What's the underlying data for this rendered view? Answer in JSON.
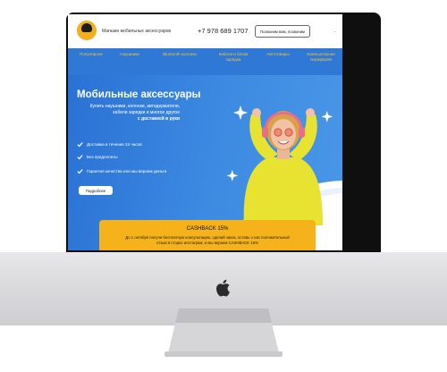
{
  "header": {
    "tagline": "Магазин мобильных аксессуаров",
    "phone": "+7 978 689 1707",
    "callback_label": "Позвоним вам, позвоним",
    "separator": "·"
  },
  "nav": {
    "items": [
      {
        "label": "Популярное"
      },
      {
        "label": "Наушники"
      },
      {
        "label": "Bluetooth колонки"
      },
      {
        "label": "Кабели и блоки зарядки"
      },
      {
        "label": "Автотовары"
      },
      {
        "label": "Компьютерная периферия"
      }
    ]
  },
  "hero": {
    "title": "Мобильные аксессуары",
    "subtitle": "Купить наушники, колонки, автодержатели, кабели зарядки и многое другое",
    "subtitle_bold": "с доставкой в руки",
    "bullets": [
      {
        "label": "Доставка в течение 24 часов"
      },
      {
        "label": "Без предоплаты"
      },
      {
        "label": "Гарантия качества или мы вернем деньги"
      }
    ],
    "more_label": "Подробнее"
  },
  "promo": {
    "title": "CASHBACK 15%",
    "line1": "До 1 октября получи бесплатную консультацию, сделай заказ, оставь о нас положительный",
    "line2": "отзыв в сторис инстаграм, и мы вернем CASHBACK 15%"
  },
  "colors": {
    "nav_bg": "#2f78d6",
    "nav_text": "#f3c531",
    "hero_bg": "#3d8be2",
    "promo_bg": "#f6b21a",
    "sweater": "#e8e231"
  },
  "icons": [
    "logo-icon",
    "cart-icon",
    "check-icon",
    "sparkle-icon",
    "apple-icon"
  ]
}
